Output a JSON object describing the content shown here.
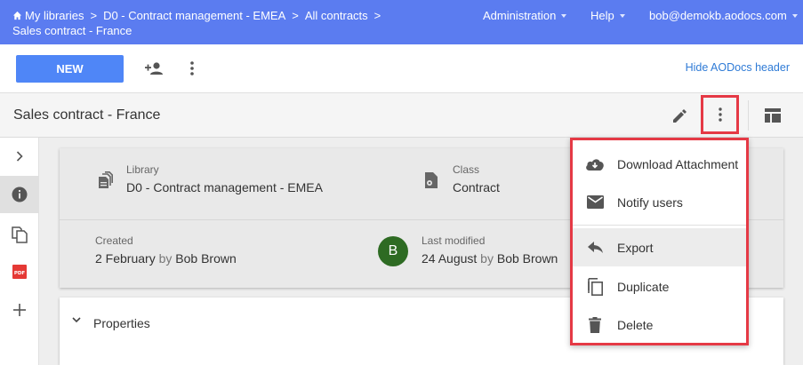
{
  "header": {
    "breadcrumb": [
      "My libraries",
      "D0 - Contract management - EMEA",
      "All contracts"
    ],
    "breadcrumb_current": "Sales contract - France",
    "admin_menu": "Administration",
    "help_menu": "Help",
    "user_menu": "bob@demokb.aodocs.com"
  },
  "toolbar": {
    "new_label": "NEW",
    "hide_header_link": "Hide AODocs header"
  },
  "document": {
    "title": "Sales contract - France"
  },
  "info": {
    "library_label": "Library",
    "library_value": "D0 - Contract management - EMEA",
    "class_label": "Class",
    "class_value": "Contract",
    "created_label": "Created",
    "created_date": "2 February",
    "created_by_word": "by",
    "created_by": "Bob Brown",
    "modified_label": "Last modified",
    "modified_date": "24 August",
    "modified_by_word": "by",
    "modified_by": "Bob Brown",
    "avatar_initial": "B"
  },
  "properties": {
    "title": "Properties"
  },
  "menu": {
    "items": [
      {
        "label": "Download Attachment",
        "icon": "cloud-download-icon"
      },
      {
        "label": "Notify users",
        "icon": "mail-icon"
      },
      {
        "label": "Export",
        "icon": "reply-icon"
      },
      {
        "label": "Duplicate",
        "icon": "copy-icon"
      },
      {
        "label": "Delete",
        "icon": "trash-icon"
      }
    ]
  },
  "rail": {
    "pdf_badge": "PDF"
  },
  "colors": {
    "header_bg": "#5b7cf0",
    "primary_button": "#4f86f7",
    "highlight_outline": "#e53945",
    "avatar_bg": "#2e6b23",
    "link": "#2f7bd6"
  }
}
